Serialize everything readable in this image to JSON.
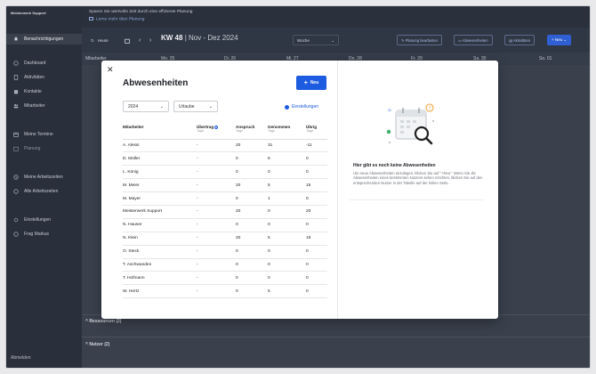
{
  "sidebar": {
    "brand": "Meisterwerk Support",
    "brand_sub": "",
    "active_item": "Benachrichtigungen",
    "section_1": "",
    "items_main": [
      "Dashboard",
      "Aktivitäten",
      "Kontakte",
      "Mitarbeiter"
    ],
    "section_2": "",
    "items_plan": [
      "Meine Termine",
      "Planung"
    ],
    "section_3": "",
    "items_time": [
      "Meine Arbeitszeiten",
      "Alle Arbeitszeiten"
    ],
    "section_4": "",
    "items_more": [
      "Einstellungen",
      "Frag Markus"
    ],
    "logout": "Abmelden"
  },
  "topbar": {
    "line1": "Sparen Sie wertvolle Zeit durch eine effiziente Planung",
    "line2": "Lerne mehr über Planung"
  },
  "toolbar": {
    "today": "Heute",
    "week_label": "KW 48",
    "range": "Nov - Dez 2024",
    "view_select": "Woche",
    "plan_edit": "Planung bearbeiten",
    "absences": "Abwesenheiten",
    "refresh": "Aktivitäten",
    "new": "+ Neu"
  },
  "days": [
    "Mitarbeiter",
    "Mo. 25",
    "Di. 26",
    "Mi. 27",
    "Do. 28",
    "Fr. 29",
    "Sa. 30",
    "So. 01"
  ],
  "grid_labels": {
    "ressourcen": "Ressourcen (2)",
    "nutzer": "Nutzer (2)"
  },
  "modal": {
    "title": "Abwesenheiten",
    "new_button": "Neu",
    "year": "2024",
    "type": "Urlaube",
    "settings": "Einstellungen",
    "columns": {
      "mitarbeiter": "Mitarbeiter",
      "uebertrag": "Übertrag",
      "uebertrag_sub": "Tage",
      "anspruch": "Anspruch",
      "anspruch_sub": "Tage",
      "genommen": "Genommen",
      "genommen_sub": "Tage",
      "uebrig": "Übrig",
      "uebrig_sub": "Tage"
    },
    "rows": [
      {
        "name": "A. Alessi",
        "uebertrag": "-",
        "anspruch": "20",
        "genommen": "31",
        "uebrig": "-11"
      },
      {
        "name": "D. Müller",
        "uebertrag": "-",
        "anspruch": "0",
        "genommen": "6",
        "uebrig": "0"
      },
      {
        "name": "L. König",
        "uebertrag": "-",
        "anspruch": "0",
        "genommen": "0",
        "uebrig": "0"
      },
      {
        "name": "M. Meier",
        "uebertrag": "-",
        "anspruch": "20",
        "genommen": "5",
        "uebrig": "15"
      },
      {
        "name": "M. Mayer",
        "uebertrag": "-",
        "anspruch": "0",
        "genommen": "1",
        "uebrig": "0"
      },
      {
        "name": "Meisterwerk Support",
        "uebertrag": "-",
        "anspruch": "20",
        "genommen": "0",
        "uebrig": "20"
      },
      {
        "name": "N. Hauser",
        "uebertrag": "-",
        "anspruch": "0",
        "genommen": "0",
        "uebrig": "0"
      },
      {
        "name": "N. Klein",
        "uebertrag": "-",
        "anspruch": "20",
        "genommen": "5",
        "uebrig": "15"
      },
      {
        "name": "O. Steck",
        "uebertrag": "-",
        "anspruch": "0",
        "genommen": "0",
        "uebrig": "0"
      },
      {
        "name": "T. Aschwanden",
        "uebertrag": "-",
        "anspruch": "0",
        "genommen": "0",
        "uebrig": "0"
      },
      {
        "name": "T. Hofmann",
        "uebertrag": "-",
        "anspruch": "0",
        "genommen": "0",
        "uebrig": "0"
      },
      {
        "name": "W. Hertz",
        "uebertrag": "-",
        "anspruch": "0",
        "genommen": "5",
        "uebrig": "0"
      }
    ],
    "empty_title": "Hier gibt es noch keine Abwesenheiten",
    "empty_text": "Um neue Abwesenheiten anzulegen, klicken Sie auf \"+Neu\". Wenn Sie die Abwesenheiten eines bestimmten Nutzers sehen möchten, klicken Sie auf den entsprechenden Nutzer in der Tabelle auf der linken Seite."
  },
  "colors": {
    "sidebar": "#2a303b",
    "accent": "#1d5be0"
  }
}
